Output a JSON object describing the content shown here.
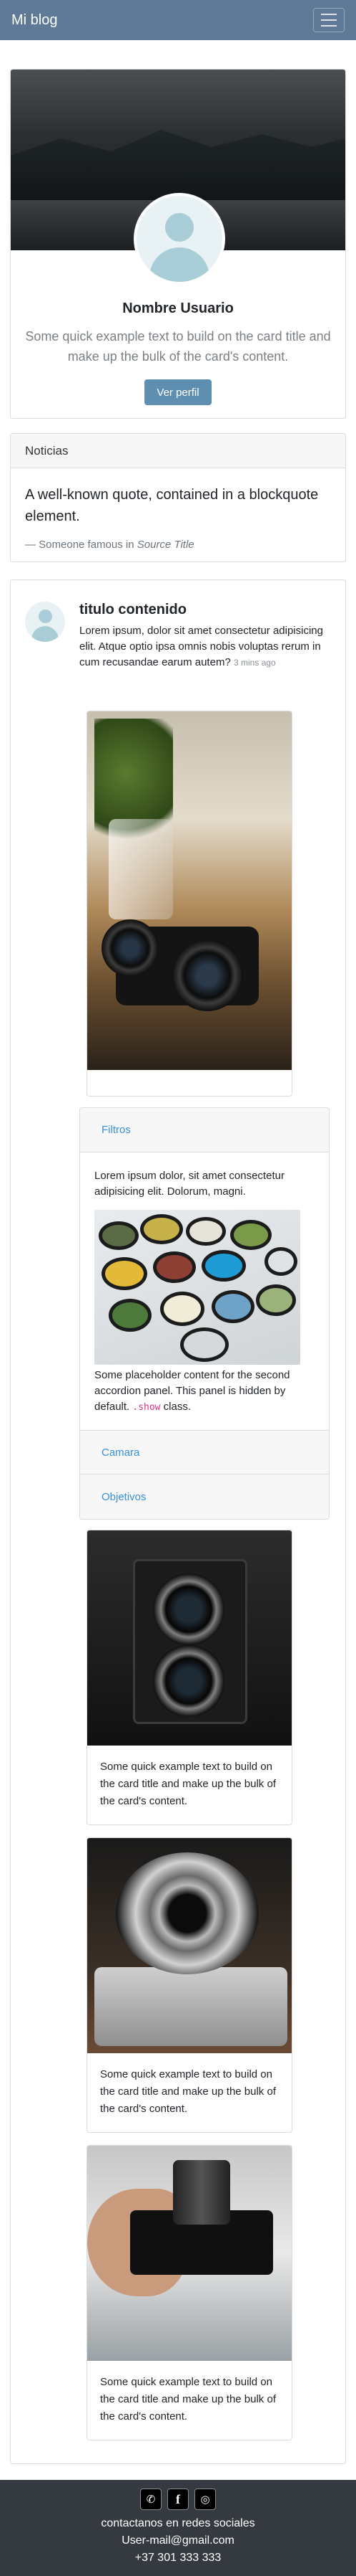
{
  "navbar": {
    "brand": "Mi blog",
    "toggler_icon": "hamburger-icon"
  },
  "profile": {
    "name": "Nombre Usuario",
    "text": "Some quick example text to build on the card title and make up the bulk of the card's content.",
    "button": "Ver perfil"
  },
  "news": {
    "header": "Noticias",
    "quote": "A well-known quote, contained in a blockquote element.",
    "footer_prefix": "— Someone famous in ",
    "footer_source": "Source Title"
  },
  "post": {
    "title": "titulo contenido",
    "body": "Lorem ipsum, dolor sit amet consectetur adipisicing elit. Atque optio ipsa omnis nobis voluptas rerum in cum recusandae earum autem?",
    "time": "3 mins ago"
  },
  "accordion": {
    "items": [
      {
        "label": "Filtros"
      },
      {
        "label": "Camara"
      },
      {
        "label": "Objetivos"
      }
    ],
    "body_text": "Lorem ipsum dolor, sit amet consectetur adipisicing elit. Dolorum, magni.",
    "panel_text_before": "Some placeholder content for the second accordion panel. This panel is hidden by default. ",
    "panel_code": ".show",
    "panel_text_after": " class."
  },
  "cards": [
    {
      "text": "Some quick example text to build on the card title and make up the bulk of the card's content."
    },
    {
      "text": "Some quick example text to build on the card title and make up the bulk of the card's content."
    },
    {
      "text": "Some quick example text to build on the card title and make up the bulk of the card's content."
    }
  ],
  "footer": {
    "icons": [
      "whatsapp-icon",
      "facebook-icon",
      "instagram-icon"
    ],
    "social": "contactanos en redes sociales",
    "email": "User-mail@gmail.com",
    "phone": "+37 301 333 333"
  }
}
